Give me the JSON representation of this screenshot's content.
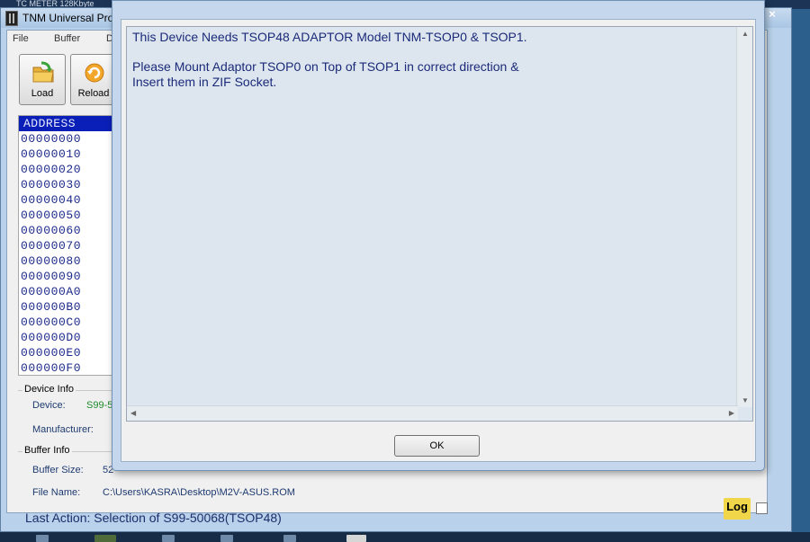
{
  "desktop": {
    "top_text": "TC METER   128Kbyte"
  },
  "main_window": {
    "title": "TNM  Universal Pro",
    "menu": [
      "File",
      "Buffer",
      "D"
    ],
    "toolbar": [
      {
        "label": "Load",
        "icon": "load-folder-icon"
      },
      {
        "label": "Reload",
        "icon": "reload-icon"
      }
    ],
    "address_panel": {
      "header": "ADDRESS",
      "rows": [
        "00000000",
        "00000010",
        "00000020",
        "00000030",
        "00000040",
        "00000050",
        "00000060",
        "00000070",
        "00000080",
        "00000090",
        "000000A0",
        "000000B0",
        "000000C0",
        "000000D0",
        "000000E0",
        "000000F0"
      ]
    },
    "device_info": {
      "title": "Device Info",
      "device_label": "Device:",
      "device_value": "S99-5",
      "manufacturer_label": "Manufacturer:"
    },
    "buffer_info": {
      "title": "Buffer Info",
      "size_label": "Buffer Size:",
      "size_value": "52",
      "file_label": "File Name:",
      "file_value": "C:\\Users\\KASRA\\Desktop\\M2V-ASUS.ROM"
    },
    "log_label": "Log",
    "status": "Last Action:  Selection of   S99-50068(TSOP48)",
    "colors": {
      "accent": "#0a1fb7",
      "device_value": "#1f8a2b",
      "status_text": "#1c2f6b"
    }
  },
  "dialog": {
    "line1": "This Device Needs  TSOP48 ADAPTOR Model TNM-TSOP0 &  TSOP1.",
    "line2": "Please Mount Adaptor TSOP0 on Top of TSOP1 in correct direction &",
    "line3": "Insert them in ZIF Socket.",
    "ok_label": "OK",
    "close_glyph": "×"
  }
}
